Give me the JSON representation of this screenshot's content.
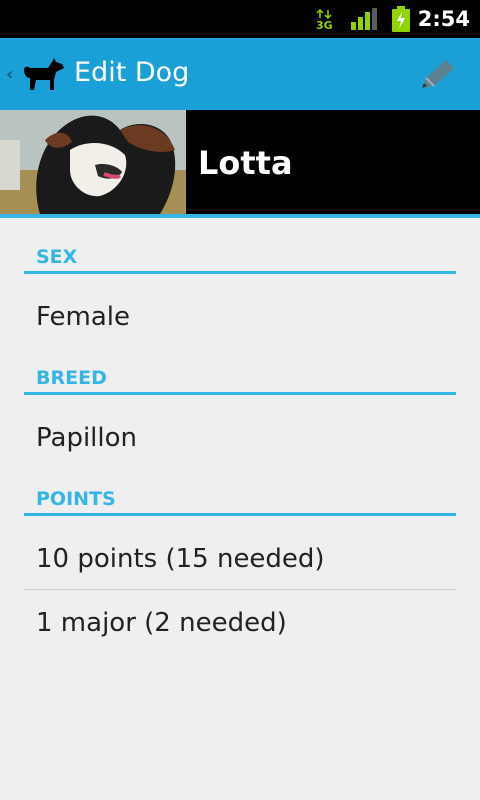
{
  "status_bar": {
    "time": "2:54",
    "network_type": "3G"
  },
  "action_bar": {
    "title": "Edit Dog"
  },
  "dog": {
    "name": "Lotta"
  },
  "sections": {
    "sex": {
      "label": "SEX",
      "value": "Female"
    },
    "breed": {
      "label": "BREED",
      "value": "Papillon"
    },
    "points": {
      "label": "POINTS",
      "rows": [
        "10 points (15 needed)",
        "1 major (2 needed)"
      ]
    }
  },
  "colors": {
    "accent": "#33b5e5",
    "action_bar": "#1a9fd6"
  },
  "icons": {
    "network": "3g-data-icon",
    "signal": "signal-strength-icon",
    "battery": "battery-charging-icon",
    "up": "up-caret-icon",
    "app": "dog-silhouette-icon",
    "edit": "pencil-icon"
  }
}
